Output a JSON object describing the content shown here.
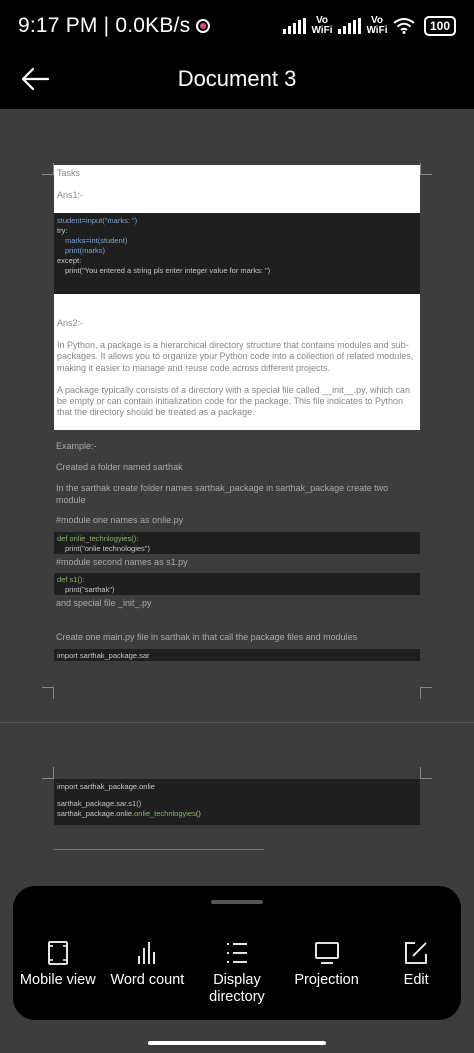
{
  "status_bar": {
    "time": "9:17 PM | 0.0KB/s",
    "vowifi_1": "Vo WiFi",
    "vowifi_2": "Vo WiFi",
    "battery": "100"
  },
  "header": {
    "title": "Document 3"
  },
  "document": {
    "tasks": "Tasks",
    "ans1": "Ans1:-",
    "code1": [
      "student=input(\"marks: \")",
      "try:",
      "    marks=int(student)",
      "    print(marks)",
      "except:",
      "    print(\"You entered a string pls enter integer value for marks: \")"
    ],
    "ans2": "Ans2:-",
    "para1": "In Python, a package is a hierarchical directory structure that contains modules and sub-packages. It allows you to organize your Python code into a collection of related modules, making it easier to manage and reuse code across different projects.",
    "para2": "A package typically consists of a directory with a special file called __init__.py, which can be empty or can contain initialization code for the package. This file indicates to Python that the directory should be treated as a package.",
    "example": "Example:-",
    "created": "Created a folder named sarthak",
    "in_sarthak": "In the sarthak create folder names sarthak_package in sarthak_package create two module",
    "module_one": "#module one names as onlie.py",
    "code2": [
      "def onlie_technlogyies():",
      "    print(\"onlie technologies\")"
    ],
    "module_two": "#module second names as s1.py",
    "code3": [
      "def s1():",
      "    print(\"sarthak\")"
    ],
    "special_file": "and special file _init_.py",
    "create_main": "Create one main.py file in sarthak in that call the package files and modules",
    "import1": "import sarthak_package.sar",
    "page2_code": [
      "import sarthak_package.onlie",
      "",
      "sarthak_package.sar.s1()",
      "sarthak_package.onlie.onlie_technlogyies()"
    ]
  },
  "toolbar": {
    "items": [
      {
        "label": "Mobile view",
        "icon": "mobile-view-icon"
      },
      {
        "label": "Word count",
        "icon": "word-count-icon"
      },
      {
        "label": "Display directory",
        "icon": "directory-icon"
      },
      {
        "label": "Projection",
        "icon": "projection-icon"
      },
      {
        "label": "Edit",
        "icon": "edit-icon"
      }
    ]
  }
}
